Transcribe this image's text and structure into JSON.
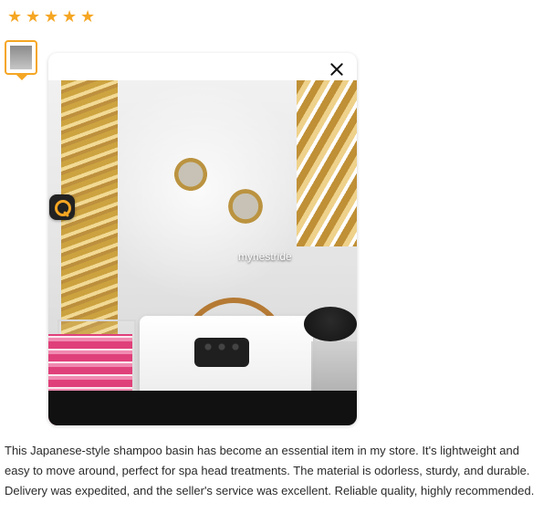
{
  "rating": {
    "stars": 5,
    "icon": "star-icon",
    "color": "#f5a623"
  },
  "thumbnail": {
    "selected": true
  },
  "viewer": {
    "close_icon": "close-icon",
    "lens_icon": "visual-search-icon",
    "watermark": "mynestride"
  },
  "review": {
    "text": "This Japanese-style shampoo basin has become an essential item in my store. It's lightweight and easy to move around, perfect for spa head treatments. The material is odorless, sturdy, and durable. Delivery was expedited, and the seller's service was excellent. Reliable quality, highly recommended."
  }
}
